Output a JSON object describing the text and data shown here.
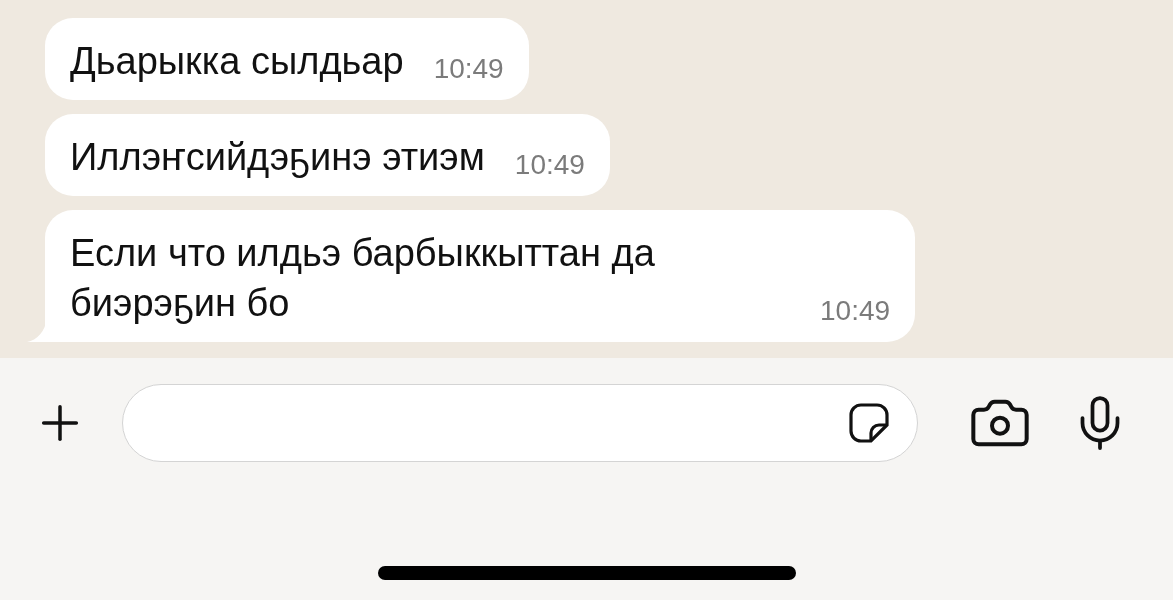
{
  "messages": [
    {
      "text": "Дьарыкка сылдьар",
      "time": "10:49",
      "tail": false
    },
    {
      "text": "Иллэҥсийдэҕинэ этиэм",
      "time": "10:49",
      "tail": false
    },
    {
      "text": "Если что илдьэ барбыккыттан да биэрэҕин бо",
      "time": "10:49",
      "tail": true
    }
  ]
}
